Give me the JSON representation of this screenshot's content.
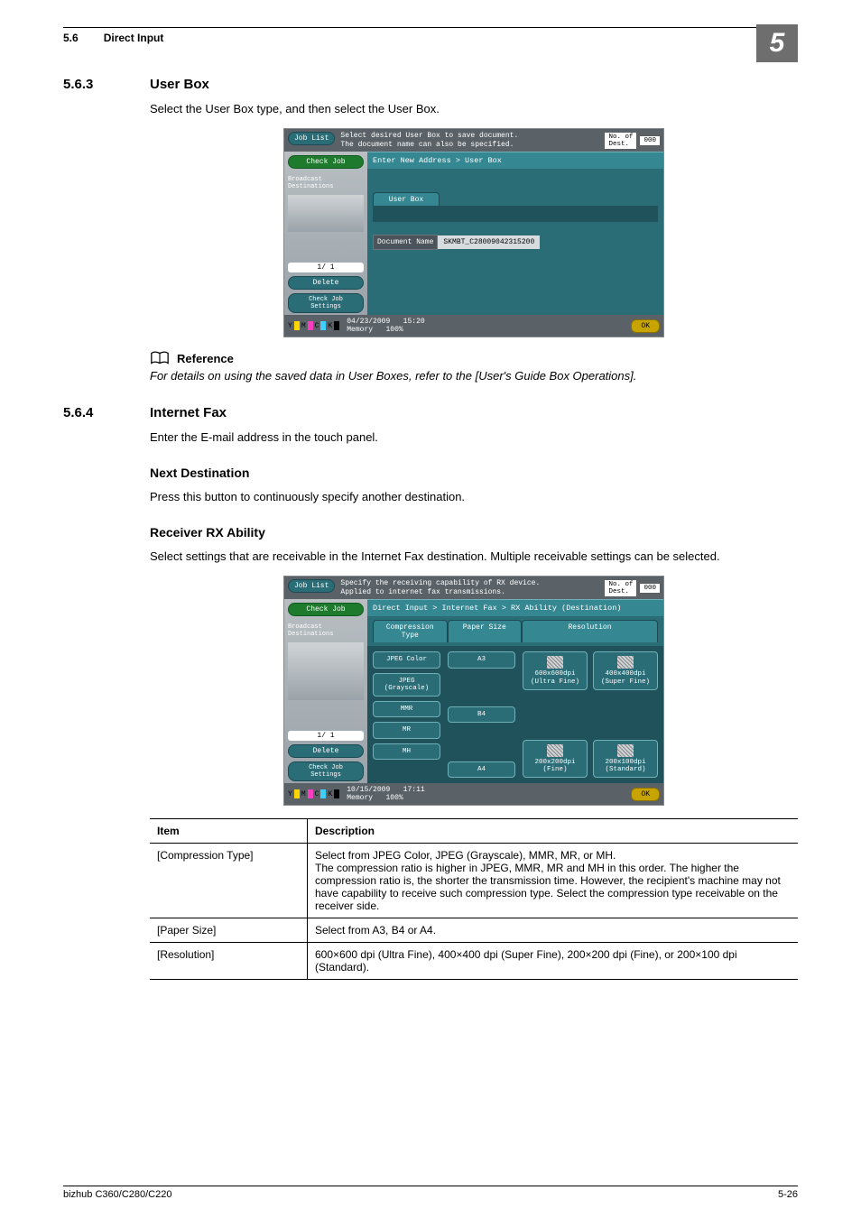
{
  "header": {
    "sec_num": "5.6",
    "sec_title": "Direct Input",
    "chapter": "5"
  },
  "h563": {
    "num": "5.6.3",
    "title": "User Box",
    "intro": "Select the User Box type, and then select the User Box."
  },
  "shot1": {
    "jobList": "Job List",
    "checkJob": "Check Job",
    "broadcast": "Broadcast\nDestinations",
    "page": "1/  1",
    "delete": "Delete",
    "checkSettings": "Check Job\nSettings",
    "topmsg": "Select desired User Box to save document.\nThe document name can also be specified.",
    "destLabel": "No. of\nDest.",
    "destVal": "000",
    "crumb": "Enter New Address > User Box",
    "userBox": "User Box",
    "docNameLabel": "Document Name",
    "docNameVal": "SKMBT_C28009042315200",
    "date": "04/23/2009",
    "time": "15:20",
    "memory": "Memory",
    "memVal": "100%",
    "ok": "OK"
  },
  "ref": {
    "label": "Reference",
    "text": "For details on using the saved data in User Boxes, refer to the [User's Guide Box Operations]."
  },
  "h564": {
    "num": "5.6.4",
    "title": "Internet Fax",
    "intro": "Enter the E-mail address in the touch panel.",
    "nextDestTitle": "Next Destination",
    "nextDestText": "Press this button to continuously specify another destination.",
    "rxTitle": "Receiver RX Ability",
    "rxText": "Select settings that are receivable in the Internet Fax destination. Multiple receivable settings can be selected."
  },
  "shot2": {
    "jobList": "Job List",
    "checkJob": "Check Job",
    "broadcast": "Broadcast\nDestinations",
    "page": "1/  1",
    "delete": "Delete",
    "checkSettings": "Check Job\nSettings",
    "topmsg": "Specify the receiving capability of RX device.\nApplied to internet fax transmissions.",
    "destLabel": "No. of\nDest.",
    "destVal": "000",
    "crumb": "Direct Input > Internet Fax > RX Ability (Destination)",
    "tabs": {
      "comp": "Compression\nType",
      "paper": "Paper Size",
      "res": "Resolution"
    },
    "opts": {
      "jpegColor": "JPEG Color",
      "jpegGray": "JPEG\n(Grayscale)",
      "mmr": "MMR",
      "mr": "MR",
      "mh": "MH",
      "a3": "A3",
      "b4": "B4",
      "a4": "A4",
      "r600": "600x600dpi\n(Ultra Fine)",
      "r400": "400x400dpi\n(Super Fine)",
      "r200a": "200x200dpi\n(Fine)",
      "r200b": "200x100dpi\n(Standard)"
    },
    "date": "10/15/2009",
    "time": "17:11",
    "memory": "Memory",
    "memVal": "100%",
    "ok": "OK"
  },
  "table": {
    "head": {
      "item": "Item",
      "desc": "Description"
    },
    "rows": [
      {
        "item": "[Compression Type]",
        "desc": "Select from JPEG Color, JPEG (Grayscale), MMR, MR, or MH.\nThe compression ratio is higher in JPEG, MMR, MR and MH in this order. The higher the compression ratio is, the shorter the transmission time. However, the recipient's machine may not have capability to receive such compression type. Select the compression type receivable on the receiver side."
      },
      {
        "item": "[Paper Size]",
        "desc": "Select from A3, B4 or A4."
      },
      {
        "item": "[Resolution]",
        "desc": "600×600 dpi (Ultra Fine), 400×400 dpi (Super Fine), 200×200 dpi (Fine), or 200×100 dpi (Standard)."
      }
    ]
  },
  "footer": {
    "product": "bizhub C360/C280/C220",
    "page": "5-26"
  }
}
